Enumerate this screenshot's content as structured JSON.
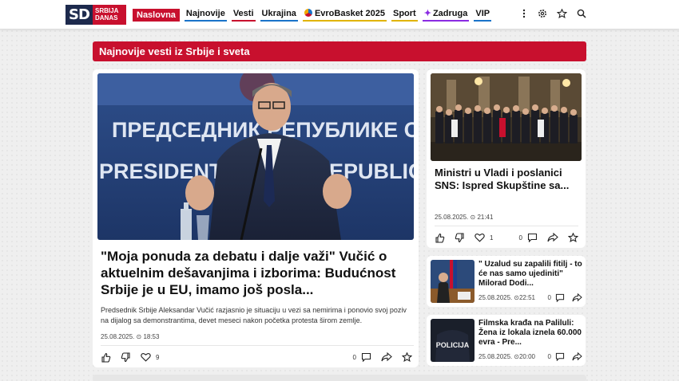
{
  "logo": {
    "mark": "SD",
    "line1": "SRBIJA",
    "line2": "DANAS"
  },
  "nav": {
    "items": [
      {
        "label": "Naslovna"
      },
      {
        "label": "Najnovije"
      },
      {
        "label": "Vesti"
      },
      {
        "label": "Ukrajina"
      },
      {
        "label": "EvroBasket 2025"
      },
      {
        "label": "Sport"
      },
      {
        "label": "Zadruga"
      },
      {
        "label": "VIP"
      }
    ]
  },
  "section": {
    "title": "Najnovije vesti iz Srbije i sveta"
  },
  "main_article": {
    "image_text_line1": "ПРЕДСЕДНИК РЕПУБЛИКЕ СРБ",
    "image_text_line2": "PRESIDENT OF THE REPUBLIC OF S",
    "title": "\"Moja ponuda za debatu i dalje važi\" Vučić o aktuelnim dešavanjima i izborima: Budućnost Srbije je u EU, imamo još posla...",
    "description": "Predsednik Srbije Aleksandar Vučić razjasnio je situaciju u vezi sa nemirima i ponovio svoj poziv na dijalog sa demonstrantima, devet meseci nakon početka protesta širom zemlje.",
    "date": "25.08.2025.",
    "time": "18:53",
    "likes": "9",
    "comments": "0"
  },
  "side_article": {
    "title": "Ministri u Vladi i poslanici SNS: Ispred Skupštine sa...",
    "date": "25.08.2025.",
    "time": "21:41",
    "likes": "1",
    "comments": "0"
  },
  "small_articles": [
    {
      "title": "\" Uzalud su zapalili fitilj - to će nas samo ujediniti\" Milorad Dodi...",
      "date": "25.08.2025.",
      "time": "22:51",
      "comments": "0"
    },
    {
      "title": "Filmska krađa na Paliluli: Žena iz lokala iznela 60.000 evra - Pre...",
      "date": "25.08.2025.",
      "time": "20:00",
      "comments": "0",
      "image_text": "POLICIJA"
    }
  ],
  "colors": {
    "accent": "#c8102e",
    "brand_dark": "#1d2a4d"
  }
}
